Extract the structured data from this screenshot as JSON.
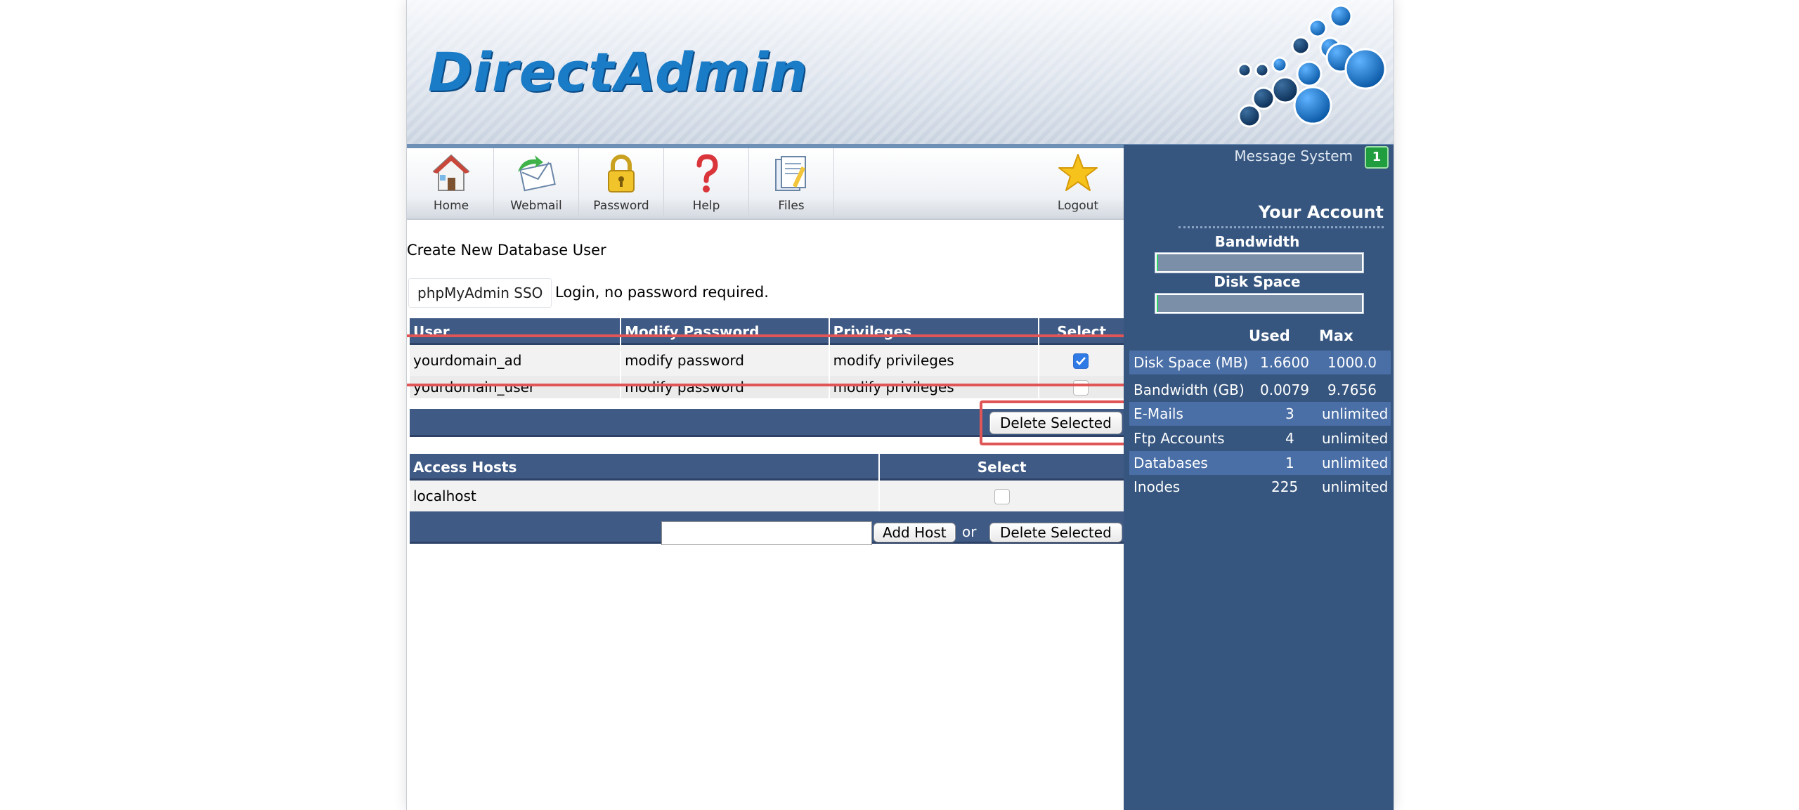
{
  "app": {
    "logo_text": "DirectAdmin",
    "brand_color": "#1a7cc7",
    "header_color": "#3f5a85"
  },
  "nav": {
    "items": [
      {
        "label": "Home",
        "icon": "home-icon"
      },
      {
        "label": "Webmail",
        "icon": "webmail-icon"
      },
      {
        "label": "Password",
        "icon": "lock-icon"
      },
      {
        "label": "Help",
        "icon": "help-icon"
      },
      {
        "label": "Files",
        "icon": "files-icon"
      }
    ],
    "logout": {
      "label": "Logout",
      "icon": "star-icon"
    }
  },
  "main": {
    "title": "Create New Database User",
    "sso": {
      "button": "phpMyAdmin SSO",
      "note": "Login, no password required."
    },
    "users_table": {
      "headers": [
        "User",
        "Modify Password",
        "Privileges",
        "Select"
      ],
      "rows": [
        {
          "user": "yourdomain_ad",
          "modify": "modify password",
          "privileges": "modify privileges",
          "selected": true
        },
        {
          "user": "yourdomain_user",
          "modify": "modify password",
          "privileges": "modify privileges",
          "selected": false
        }
      ],
      "delete_button": "Delete Selected"
    },
    "hosts_table": {
      "headers": [
        "Access Hosts",
        "Select"
      ],
      "rows": [
        {
          "host": "localhost",
          "selected": false
        }
      ],
      "host_input_value": "",
      "add_button": "Add Host",
      "or_text": "or",
      "delete_button": "Delete Selected"
    }
  },
  "sidebar": {
    "message_system": "Message System",
    "message_count": "1",
    "account_title": "Your Account",
    "bandwidth_label": "Bandwidth",
    "disk_label": "Disk Space",
    "bandwidth_usage_fraction": 8e-07,
    "disk_usage_fraction": 0.00166,
    "stats_headers": {
      "used": "Used",
      "max": "Max"
    },
    "stats": [
      {
        "label": "Disk Space (MB)",
        "used": "1.6600",
        "max": "1000.0"
      },
      {
        "label": "Bandwidth (GB)",
        "used": "0.0079",
        "max": "9.7656"
      },
      {
        "label": "E-Mails",
        "used": "3",
        "max": "unlimited"
      },
      {
        "label": "Ftp Accounts",
        "used": "4",
        "max": "unlimited"
      },
      {
        "label": "Databases",
        "used": "1",
        "max": "unlimited"
      },
      {
        "label": "Inodes",
        "used": "225",
        "max": "unlimited"
      }
    ]
  }
}
